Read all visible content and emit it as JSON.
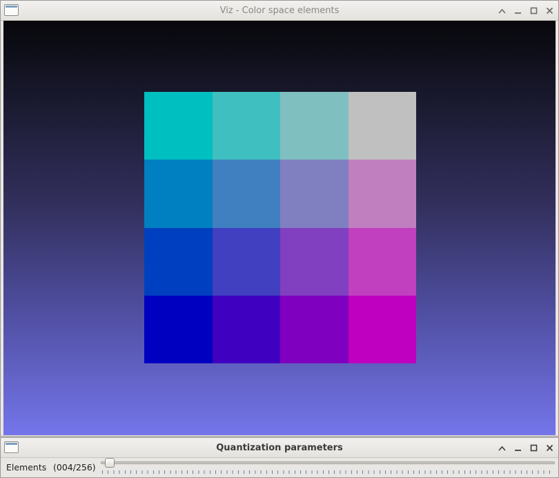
{
  "viz_window": {
    "title": "Viz - Color space elements",
    "controls": [
      "up-arrow-icon",
      "minimize-icon",
      "maximize-icon",
      "close-icon"
    ],
    "grid_colors": [
      "#00bfc0",
      "#40bfc0",
      "#80bfc0",
      "#c0c0c0",
      "#0080c0",
      "#4080c0",
      "#8080c0",
      "#c080c0",
      "#0040c0",
      "#4040c0",
      "#8040c0",
      "#c040c0",
      "#0000c0",
      "#4000c0",
      "#8000c0",
      "#c000c0"
    ]
  },
  "quant_window": {
    "title": "Quantization parameters",
    "slider": {
      "label": "Elements",
      "value_text": "(004/256)",
      "value": 4,
      "max": 256
    }
  }
}
